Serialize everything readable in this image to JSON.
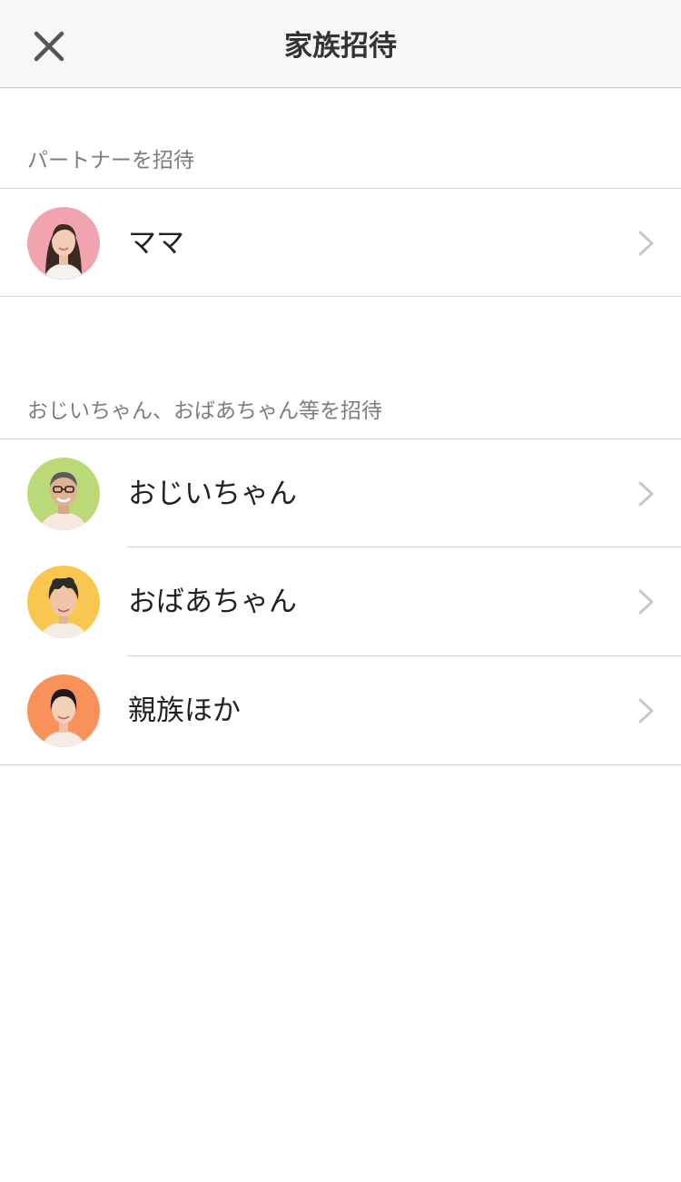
{
  "nav": {
    "title": "家族招待",
    "close_icon": "close-icon"
  },
  "sections": [
    {
      "header": "パートナーを招待",
      "items": [
        {
          "label": "ママ",
          "avatar_color": "#f2a3b0"
        }
      ]
    },
    {
      "header": "おじいちゃん、おばあちゃん等を招待",
      "items": [
        {
          "label": "おじいちゃん",
          "avatar_color": "#bcd97a"
        },
        {
          "label": "おばあちゃん",
          "avatar_color": "#f9c74f"
        },
        {
          "label": "親族ほか",
          "avatar_color": "#f8915a"
        }
      ]
    }
  ],
  "colors": {
    "nav_background": "#f7f7f7",
    "separator": "#d6d6d6",
    "section_header_text": "#7d7d7d",
    "chevron": "#c7c7cc"
  }
}
